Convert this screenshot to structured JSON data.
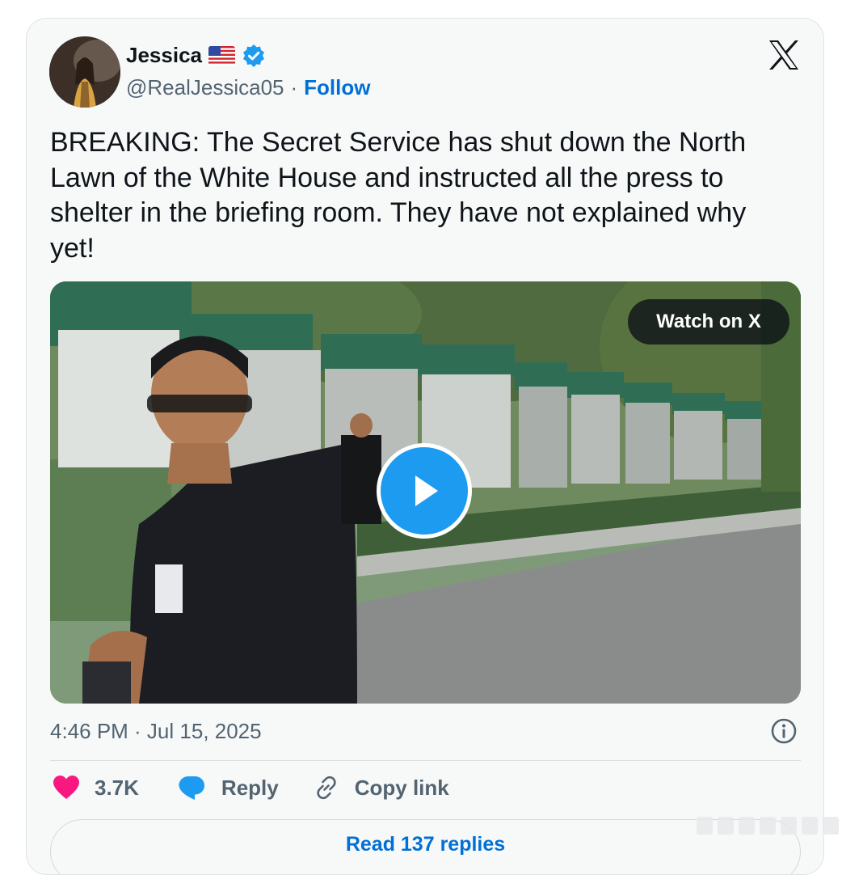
{
  "author": {
    "name": "Jessica",
    "handle": "@RealJessica05",
    "separator": "·",
    "follow_label": "Follow"
  },
  "tweet": {
    "text": "BREAKING: The Secret Service has shut down the North Lawn of the White House and instructed all the press to shelter in the briefing room. They have not explained why yet!",
    "timestamp": "4:46 PM · Jul 15, 2025"
  },
  "media": {
    "watch_label": "Watch on X"
  },
  "actions": {
    "like_count": "3.7K",
    "reply_label": "Reply",
    "copy_label": "Copy link"
  },
  "footer": {
    "read_replies_label": "Read 137 replies"
  },
  "colors": {
    "link": "#006fd6",
    "verified": "#1d9bf0",
    "like": "#f91880",
    "reply": "#1d9bf0",
    "muted": "#536471",
    "card_bg": "#f7f9f9"
  },
  "icons": [
    "us-flag-icon",
    "verified-badge-icon",
    "x-logo-icon",
    "play-icon",
    "info-icon",
    "heart-icon",
    "reply-bubble-icon",
    "link-icon"
  ]
}
